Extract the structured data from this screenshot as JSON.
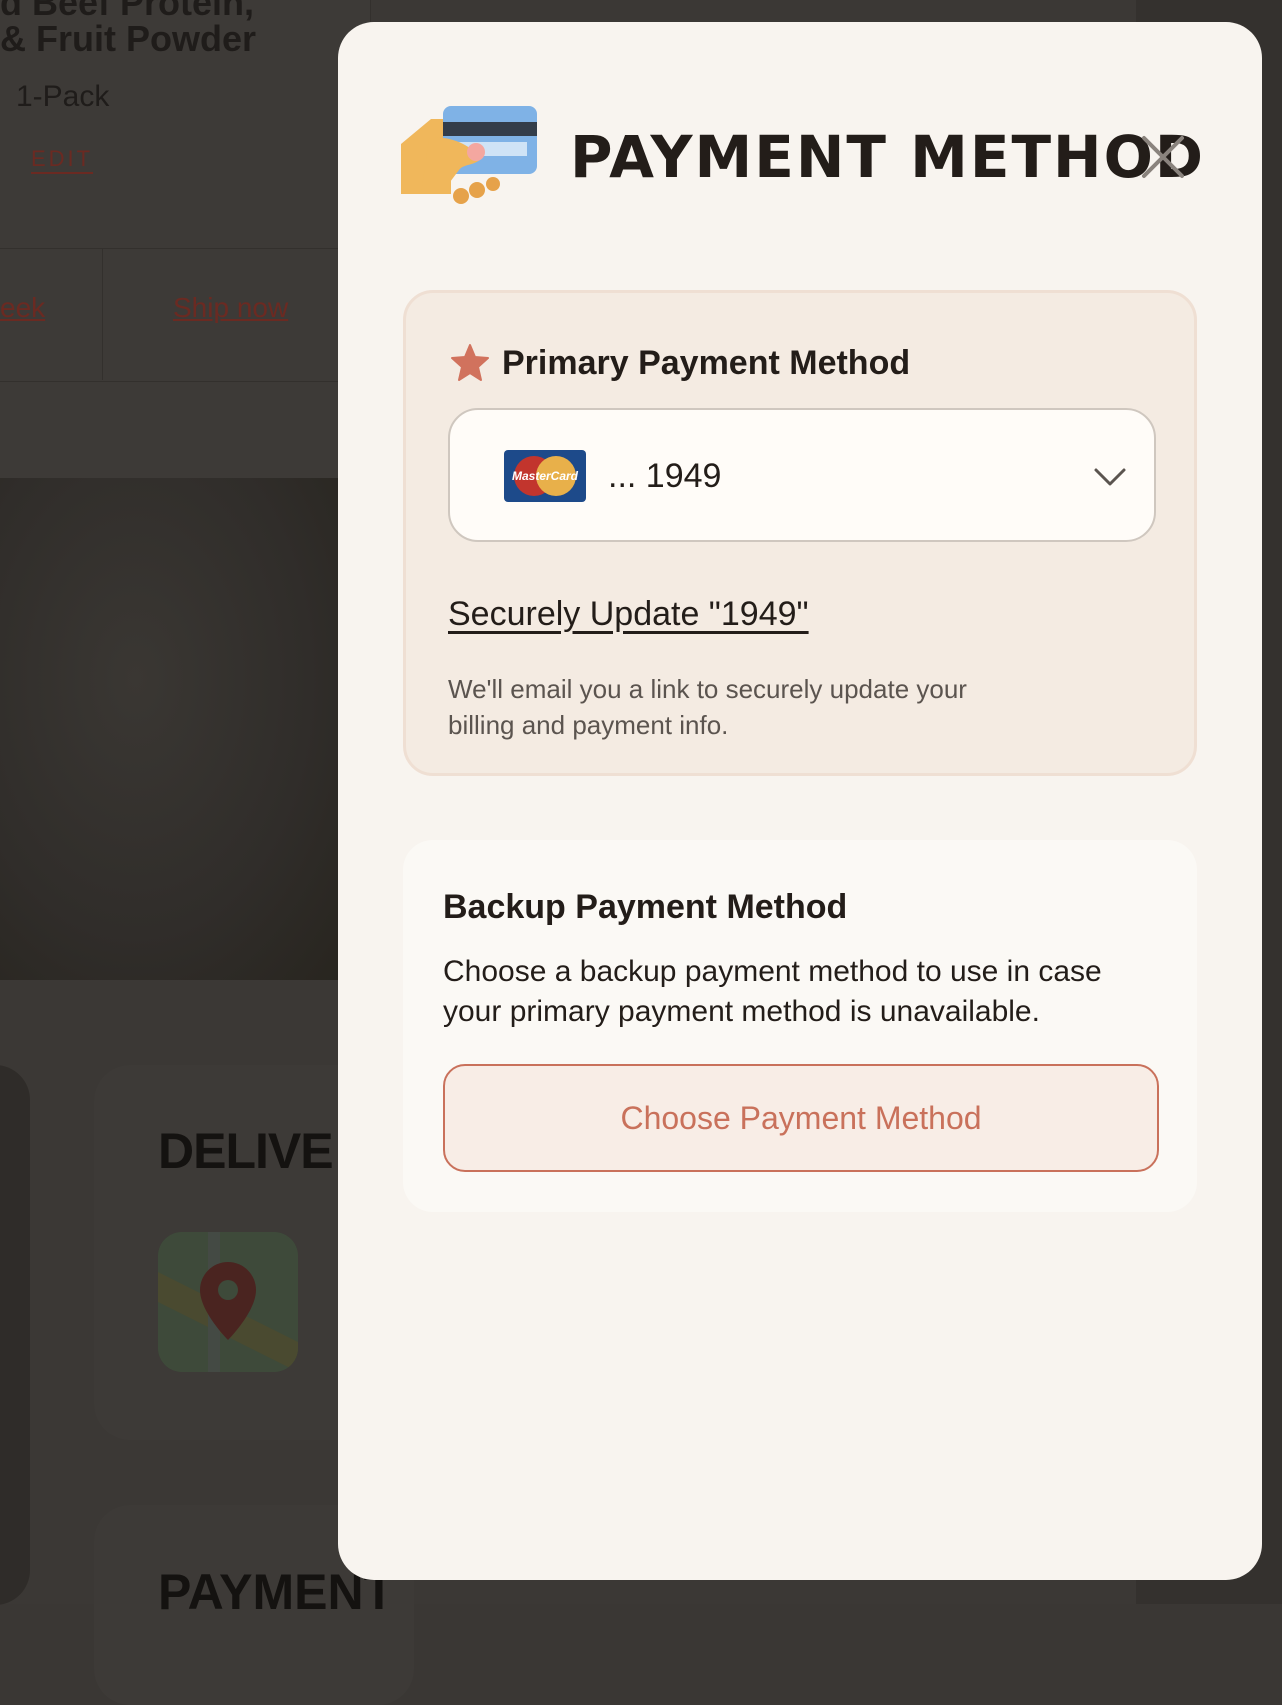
{
  "background": {
    "product_title_line1": "d Beef Protein,",
    "product_title_line2": "& Fruit Powder",
    "pack": "1-Pack",
    "edit_label": "EDIT",
    "week_link": "eek",
    "ship_now_link": "Ship now",
    "delivery_heading": "DELIVE",
    "payment_heading": "PAYMENT"
  },
  "modal": {
    "title": "PAYMENT METHOD",
    "header_icon": "hand-holding-card-icon",
    "close_icon": "close-icon",
    "primary": {
      "label": "Primary Payment Method",
      "star_icon": "star-icon",
      "selected_card": {
        "brand": "MasterCard",
        "number": "... 1949"
      },
      "update_link": "Securely Update \"1949\"",
      "help_text": "We'll email you a link to securely update your billing and payment info."
    },
    "backup": {
      "label": "Backup Payment Method",
      "description": "Choose a backup payment method to use in case your primary payment method is unavailable.",
      "button_label": "Choose Payment Method"
    }
  },
  "colors": {
    "accent": "#c9715b",
    "modal_bg": "#f8f4ef",
    "primary_box_bg": "#f4ebe2",
    "text": "#231d19"
  }
}
